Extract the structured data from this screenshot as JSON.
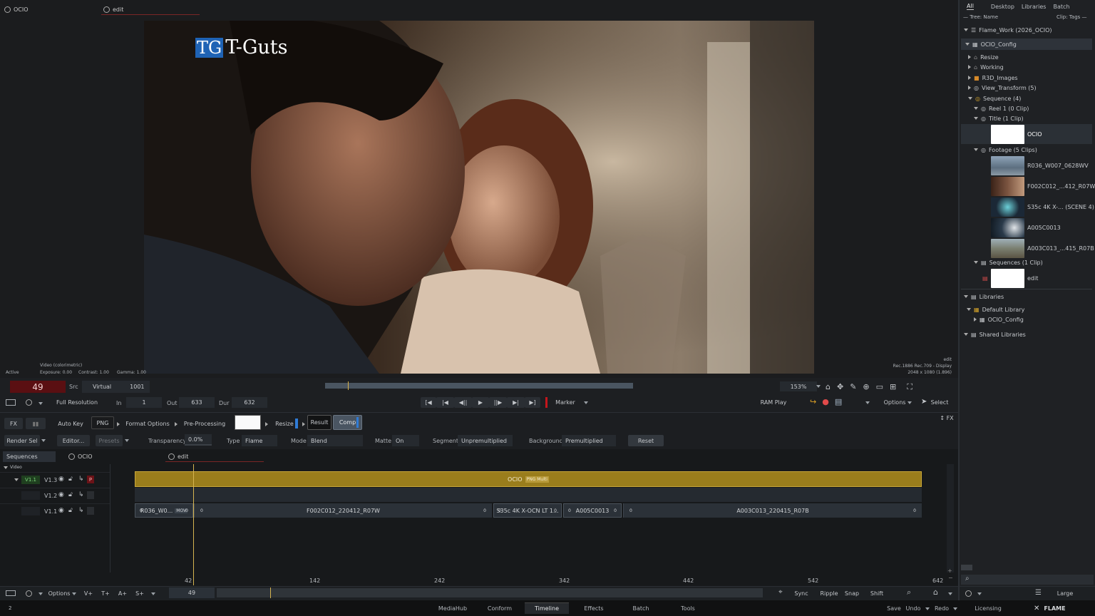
{
  "viewer": {
    "tab_left": "OCIO",
    "tab_right": "edit",
    "logo_tg": "TG",
    "logo_text": "T-Guts",
    "info_mode": "Video (colorimetric)",
    "info_active": "Active",
    "info_exposure": "Exposure: 0.00",
    "info_contrast": "Contrast: 1.00",
    "info_gamma": "Gamma: 1.00",
    "info_right_1": "edit",
    "info_right_2": "Rec.1886 Rec.709 - Display",
    "info_right_3": "2048 x 1080 (1.896)"
  },
  "controls": {
    "frame": "49",
    "src": "Src",
    "virtual": "Virtual",
    "tc": "1001",
    "zoom": "153%",
    "full_res": "Full Resolution",
    "in_label": "In",
    "in_value": "1",
    "out_label": "Out",
    "out_value": "633",
    "dur_label": "Dur",
    "dur_value": "632",
    "marker": "Marker",
    "ram_play": "RAM Play",
    "options": "Options",
    "select": "Select"
  },
  "fx": {
    "fx": "FX",
    "auto_key": "Auto Key",
    "png": "PNG",
    "format_options": "Format Options",
    "pre_processing": "Pre-Processing",
    "resize": "Resize",
    "result": "Result",
    "comp": "Comp",
    "fx_right": "FX",
    "render_sel": "Render Sel",
    "editor": "Editor...",
    "presets": "Presets",
    "transparency_label": "Transparency",
    "transparency_value": "0.0%",
    "type_label": "Type",
    "type_value": "Flame",
    "mode_label": "Mode",
    "mode_value": "Blend",
    "matte_label": "Matte",
    "matte_value": "On",
    "segment_label": "Segment",
    "segment_value": "Unpremultiplied",
    "background_label": "Background",
    "background_value": "Premultiplied",
    "reset": "Reset"
  },
  "timeline": {
    "sequences": "Sequences",
    "tab_ocio": "OCIO",
    "tab_edit": "edit",
    "video": "Video",
    "tracks": [
      {
        "a": "V1.1",
        "b": "V1.3"
      },
      {
        "a": "",
        "b": "V1.2"
      },
      {
        "a": "",
        "b": "V1.1"
      }
    ],
    "p_badge": "P",
    "title_clip": "OCIO",
    "title_tags": "PNG Multi",
    "segments": [
      {
        "name": "R036_W0...",
        "tag": "MOV",
        "l": "0",
        "r": "0"
      },
      {
        "name": "F002C012_220412_R07W",
        "l": "0",
        "r": "0"
      },
      {
        "name": "S35c 4K X-OCN LT 1...",
        "l": "0",
        "r": "0"
      },
      {
        "name": "A005C0013",
        "l": "0",
        "r": "0"
      },
      {
        "name": "A003C013_220415_R07B",
        "l": "0",
        "r": "0"
      }
    ],
    "ruler": [
      "42",
      "142",
      "242",
      "342",
      "442",
      "542",
      "642"
    ],
    "bottom_options": "Options",
    "btn_v": "V+",
    "btn_t": "T+",
    "btn_a": "A+",
    "btn_s": "S+",
    "frame": "49",
    "sync": "Sync",
    "ripple": "Ripple",
    "snap": "Snap",
    "shift": "Shift"
  },
  "nav": {
    "tabs": [
      "MediaHub",
      "Conform",
      "Timeline",
      "Effects",
      "Batch",
      "Tools"
    ],
    "active": "Timeline",
    "save": "Save",
    "undo": "Undo",
    "redo": "Redo",
    "licensing": "Licensing",
    "flame": "FLAME",
    "corner": "2"
  },
  "browser": {
    "tabs": [
      "All",
      "Desktop",
      "Libraries",
      "Batch"
    ],
    "tree_name": "— Tree: Name",
    "clip_tags": "Clip: Tags —",
    "rows": {
      "root": "Flame_Work (2026_OCIO)",
      "config": "OCIO_Config",
      "resize": "Resize",
      "working": "Working",
      "r3d": "R3D_Images",
      "view_transform": "View_Transform (5)",
      "sequence": "Sequence (4)",
      "reel1": "Reel 1 (0 Clip)",
      "title": "Title (1 Clip)",
      "ocio_clip": "OCIO",
      "footage": "Footage (5 Clips)",
      "clip1": "R036_W007_0628WV",
      "clip2": "F002C012_...412_R07W",
      "clip3": "S35c 4K X-... (SCENE 4)",
      "clip4": "A005C0013",
      "clip5": "A003C013_...415_R07B",
      "sequences": "Sequences (1 Clip)",
      "edit_clip": "edit",
      "libraries": "Libraries",
      "default_library": "Default Library",
      "lib_config": "OCIO_Config",
      "shared": "Shared Libraries"
    },
    "large": "Large"
  }
}
